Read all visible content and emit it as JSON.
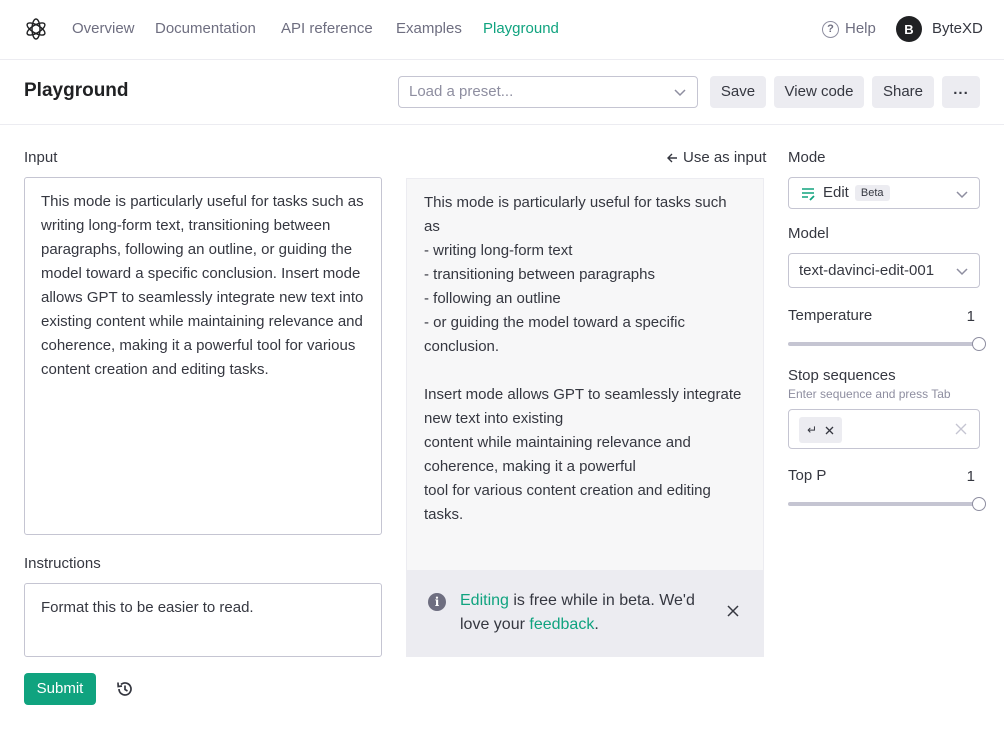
{
  "nav": {
    "items": [
      {
        "label": "Overview"
      },
      {
        "label": "Documentation"
      },
      {
        "label": "API reference"
      },
      {
        "label": "Examples"
      },
      {
        "label": "Playground"
      }
    ],
    "help_label": "Help",
    "avatar_initial": "B",
    "username": "ByteXD"
  },
  "header": {
    "title": "Playground",
    "preset_placeholder": "Load a preset...",
    "save_label": "Save",
    "view_code_label": "View code",
    "share_label": "Share",
    "more_label": "..."
  },
  "editor": {
    "input_label": "Input",
    "input_text": "This mode is particularly useful for tasks such as writing long-form text, transitioning between paragraphs, following an outline, or guiding the model toward a specific conclusion. Insert mode allows GPT to seamlessly integrate new text into existing content while maintaining relevance and coherence, making it a powerful tool for various content creation and editing tasks.",
    "use_as_input_label": "Use as input",
    "output_text": "This mode is particularly useful for tasks such as\n- writing long-form text\n- transitioning between paragraphs\n- following an outline\n- or guiding the model toward a specific conclusion.\n\nInsert mode allows GPT to seamlessly integrate new text into existing\ncontent while maintaining relevance and coherence, making it a powerful\ntool for various content creation and editing tasks.",
    "instructions_label": "Instructions",
    "instructions_text": "Format this to be easier to read.",
    "submit_label": "Submit"
  },
  "notice": {
    "link1": "Editing",
    "text1": " is free while in beta. We'd love your ",
    "link2": "feedback",
    "text2": "."
  },
  "settings": {
    "mode_label": "Mode",
    "mode_value": "Edit",
    "mode_badge": "Beta",
    "model_label": "Model",
    "model_value": "text-davinci-edit-001",
    "temperature_label": "Temperature",
    "temperature_value": "1",
    "temperature_fraction": 1,
    "stop_label": "Stop sequences",
    "stop_hint": "Enter sequence and press Tab",
    "stop_chip": "↵",
    "top_p_label": "Top P",
    "top_p_value": "1",
    "top_p_fraction": 1
  },
  "colors": {
    "accent": "#10a37f",
    "text": "#353740",
    "muted": "#6e6e80"
  }
}
